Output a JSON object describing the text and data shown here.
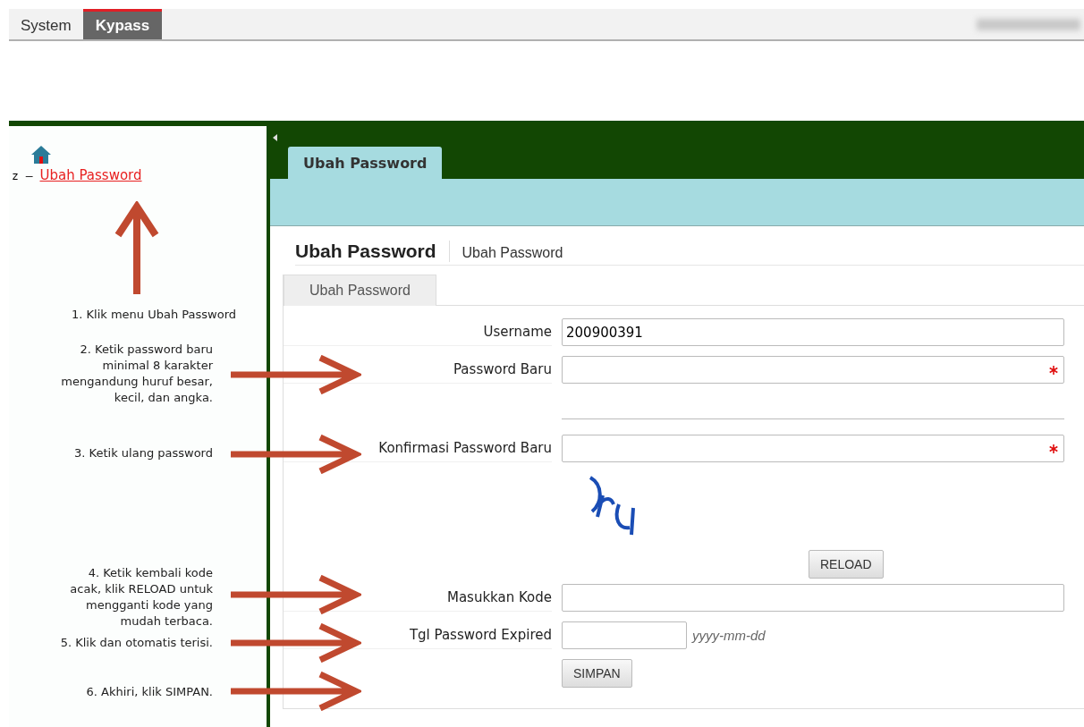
{
  "top_menu": [
    {
      "label": "System",
      "selected": false
    },
    {
      "label": "Kypass",
      "selected": true
    }
  ],
  "sidebar": {
    "items": [
      {
        "prefix": "z –",
        "label": "Ubah Password"
      }
    ]
  },
  "annotations": [
    {
      "text": "1. Klik menu Ubah Password",
      "kind": "up"
    },
    {
      "text": "2. Ketik password baru minimal 8 karakter mengandung huruf besar, kecil, dan angka.",
      "kind": "right"
    },
    {
      "text": "3. Ketik ulang password",
      "kind": "right"
    },
    {
      "text": "4. Ketik kembali kode acak, klik RELOAD untuk mengganti kode yang mudah terbaca.",
      "kind": "right"
    },
    {
      "text": "5. Klik dan otomatis terisi.",
      "kind": "right"
    },
    {
      "text": "6. Akhiri, klik SIMPAN.",
      "kind": "right"
    }
  ],
  "page_tab": {
    "label": "Ubah Password",
    "selected": true
  },
  "heading": {
    "title": "Ubah Password",
    "breadcrumb": "Ubah Password"
  },
  "form_tab": {
    "label": "Ubah Password"
  },
  "form": [
    {
      "kind": "text",
      "label": "Username",
      "value": "200900391",
      "required": false
    },
    {
      "kind": "password",
      "label": "Password Baru",
      "required": true
    },
    {
      "kind": "spacer"
    },
    {
      "kind": "password",
      "label": "Konfirmasi Password Baru",
      "required": true
    },
    {
      "kind": "captcha",
      "button": "RELOAD"
    },
    {
      "kind": "text",
      "label": "Masukkan Kode",
      "required": false
    },
    {
      "kind": "date",
      "label": "Tgl Password Expired",
      "hint": "yyyy-mm-dd"
    },
    {
      "kind": "submit",
      "button": "SIMPAN"
    }
  ]
}
